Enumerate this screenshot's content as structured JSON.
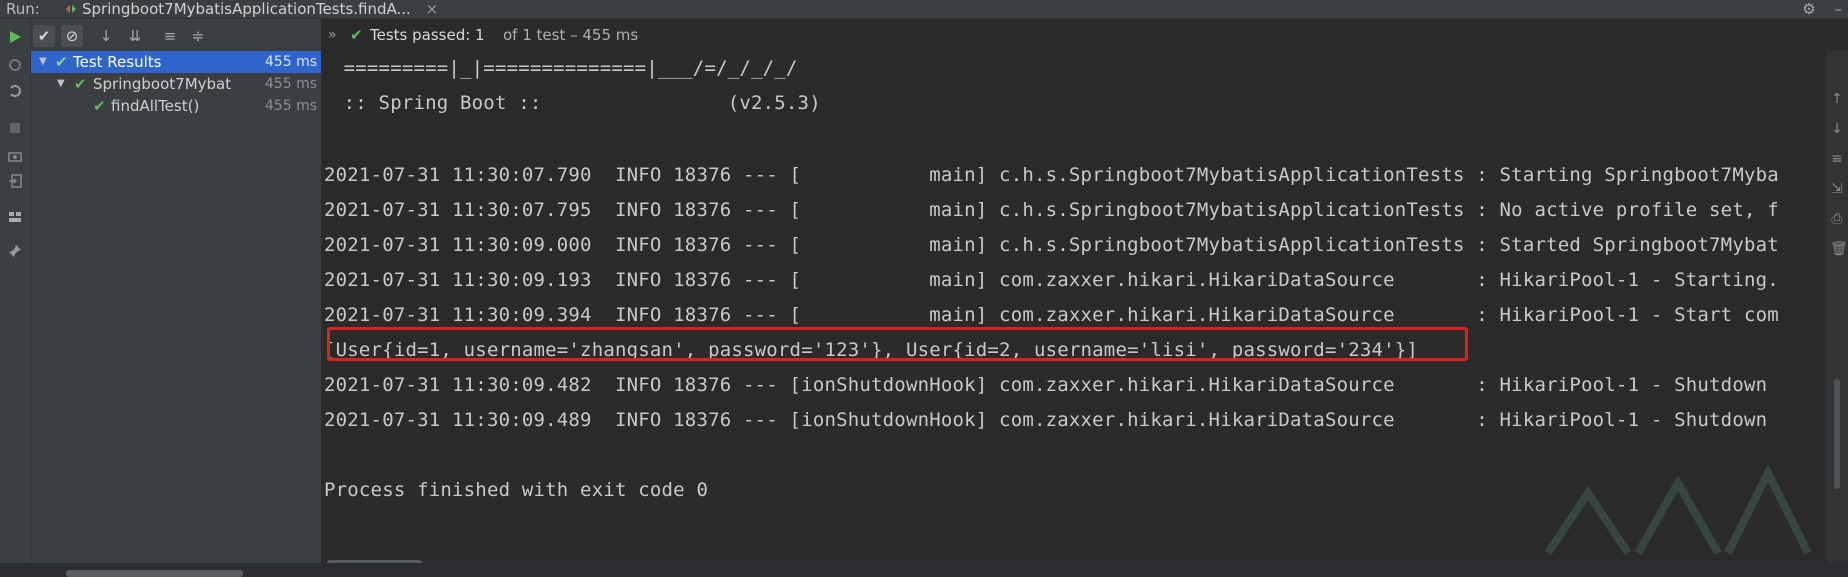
{
  "runbar": {
    "run_label": "Run:",
    "tab_label": "Springboot7MybatisApplicationTests.findA...",
    "tab_close": "×",
    "gear_glyph": "⚙",
    "minimize_glyph": "–"
  },
  "toolbar": {
    "passed_filter_glyph": "✔",
    "ignored_filter_glyph": "⊘",
    "sort_alpha_glyph": "↓",
    "sort_duration_glyph": "⇊",
    "expand_all_glyph": "≡",
    "collapse_all_glyph": "≑"
  },
  "status": {
    "chevron": "»",
    "main": "Tests passed: 1",
    "sub": " of 1 test – 455 ms"
  },
  "tree": {
    "items": [
      {
        "label": "Test Results",
        "time": "455 ms"
      },
      {
        "label": "Springboot7Mybat",
        "time": "455 ms"
      },
      {
        "label": "findAllTest()",
        "time": "455 ms"
      }
    ]
  },
  "console": {
    "lines": [
      " =========|_|==============|___/=/_/_/_/",
      " :: Spring Boot ::                (v2.5.3)",
      "",
      "2021-07-31 11:30:07.790  INFO 18376 --- [           main] c.h.s.Springboot7MybatisApplicationTests : Starting Springboot7Myba",
      "2021-07-31 11:30:07.795  INFO 18376 --- [           main] c.h.s.Springboot7MybatisApplicationTests : No active profile set, f",
      "2021-07-31 11:30:09.000  INFO 18376 --- [           main] c.h.s.Springboot7MybatisApplicationTests : Started Springboot7Mybat",
      "2021-07-31 11:30:09.193  INFO 18376 --- [           main] com.zaxxer.hikari.HikariDataSource       : HikariPool-1 - Starting.",
      "2021-07-31 11:30:09.394  INFO 18376 --- [           main] com.zaxxer.hikari.HikariDataSource       : HikariPool-1 - Start com",
      "[User{id=1, username='zhangsan', password='123'}, User{id=2, username='lisi', password='234'}]",
      "2021-07-31 11:30:09.482  INFO 18376 --- [ionShutdownHook] com.zaxxer.hikari.HikariDataSource       : HikariPool-1 - Shutdown",
      "2021-07-31 11:30:09.489  INFO 18376 --- [ionShutdownHook] com.zaxxer.hikari.HikariDataSource       : HikariPool-1 - Shutdown",
      "",
      "Process finished with exit code 0"
    ]
  },
  "colors": {
    "pass_green": "#5fb95f",
    "selection_blue": "#2f65ca",
    "highlight_red": "#e02020"
  }
}
